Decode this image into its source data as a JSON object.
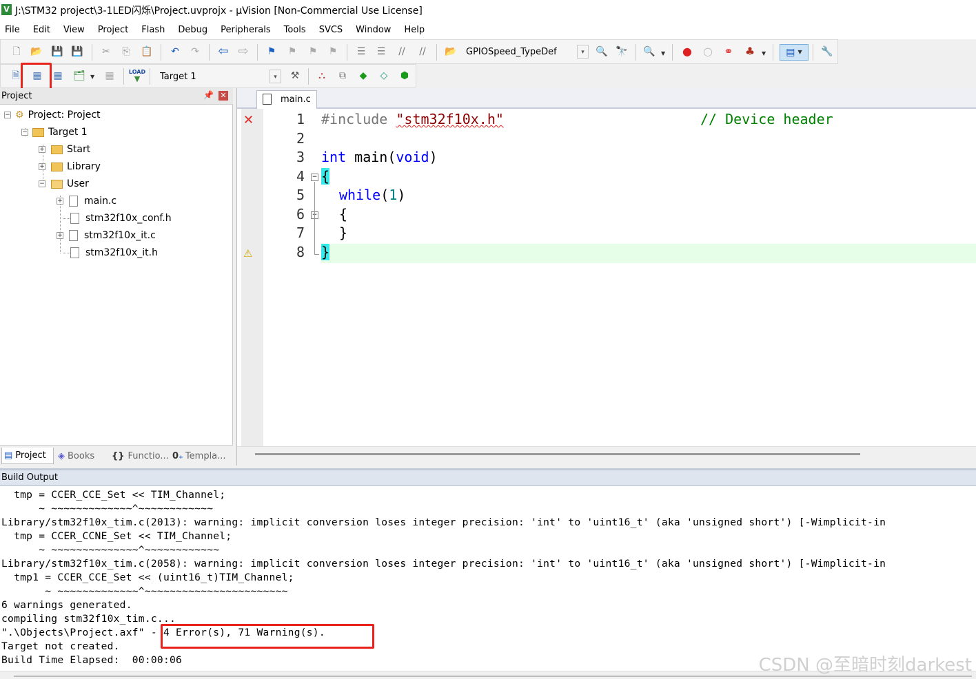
{
  "window": {
    "title": "J:\\STM32 project\\3-1LED闪烁\\Project.uvprojx - µVision  [Non-Commercial Use License]",
    "logo_letter": "V"
  },
  "menu": [
    "File",
    "Edit",
    "View",
    "Project",
    "Flash",
    "Debug",
    "Peripherals",
    "Tools",
    "SVCS",
    "Window",
    "Help"
  ],
  "toolbar": {
    "find_combo_value": "GPIOSpeed_TypeDef",
    "target_combo_value": "Target 1",
    "load_label": "LOAD"
  },
  "project_panel": {
    "title": "Project",
    "tree": {
      "root": "Project: Project",
      "target": "Target 1",
      "groups": [
        "Start",
        "Library",
        "User"
      ],
      "user_files": [
        "main.c",
        "stm32f10x_conf.h",
        "stm32f10x_it.c",
        "stm32f10x_it.h"
      ]
    },
    "bottom_tabs": [
      "Project",
      "Books",
      "Functio...",
      "Templa..."
    ]
  },
  "editor": {
    "tab_label": "main.c",
    "line_numbers": [
      "1",
      "2",
      "3",
      "4",
      "5",
      "6",
      "7",
      "8"
    ],
    "code": {
      "l1_directive": "#include",
      "l1_header": "\"stm32f10x.h\"",
      "l1_comment": "// Device header",
      "l3_type": "int",
      "l3_name": " main",
      "l3_paren_open": "(",
      "l3_void": "void",
      "l3_paren_close": ")",
      "l4": "{",
      "l5_kw": "while",
      "l5_open": "(",
      "l5_num": "1",
      "l5_close": ")",
      "l6": "{",
      "l7": "}",
      "l8": "}"
    },
    "markers": {
      "line1": "error",
      "line8": "warning"
    }
  },
  "build_output": {
    "title": "Build Output",
    "lines": [
      "  tmp = CCER_CCE_Set << TIM_Channel;",
      "      ~ ~~~~~~~~~~~~~^~~~~~~~~~~~~",
      "Library/stm32f10x_tim.c(2013): warning: implicit conversion loses integer precision: 'int' to 'uint16_t' (aka 'unsigned short') [-Wimplicit-in",
      "  tmp = CCER_CCNE_Set << TIM_Channel;",
      "      ~ ~~~~~~~~~~~~~~^~~~~~~~~~~~~",
      "Library/stm32f10x_tim.c(2058): warning: implicit conversion loses integer precision: 'int' to 'uint16_t' (aka 'unsigned short') [-Wimplicit-in",
      "  tmp1 = CCER_CCE_Set << (uint16_t)TIM_Channel;",
      "       ~ ~~~~~~~~~~~~~^~~~~~~~~~~~~~~~~~~~~~~~",
      "6 warnings generated.",
      "compiling stm32f10x_tim.c...",
      "\".\\Objects\\Project.axf\" - 4 Error(s), 71 Warning(s).",
      "Target not created.",
      "Build Time Elapsed:  00:00:06"
    ]
  },
  "watermark": "CSDN @至暗时刻darkest"
}
